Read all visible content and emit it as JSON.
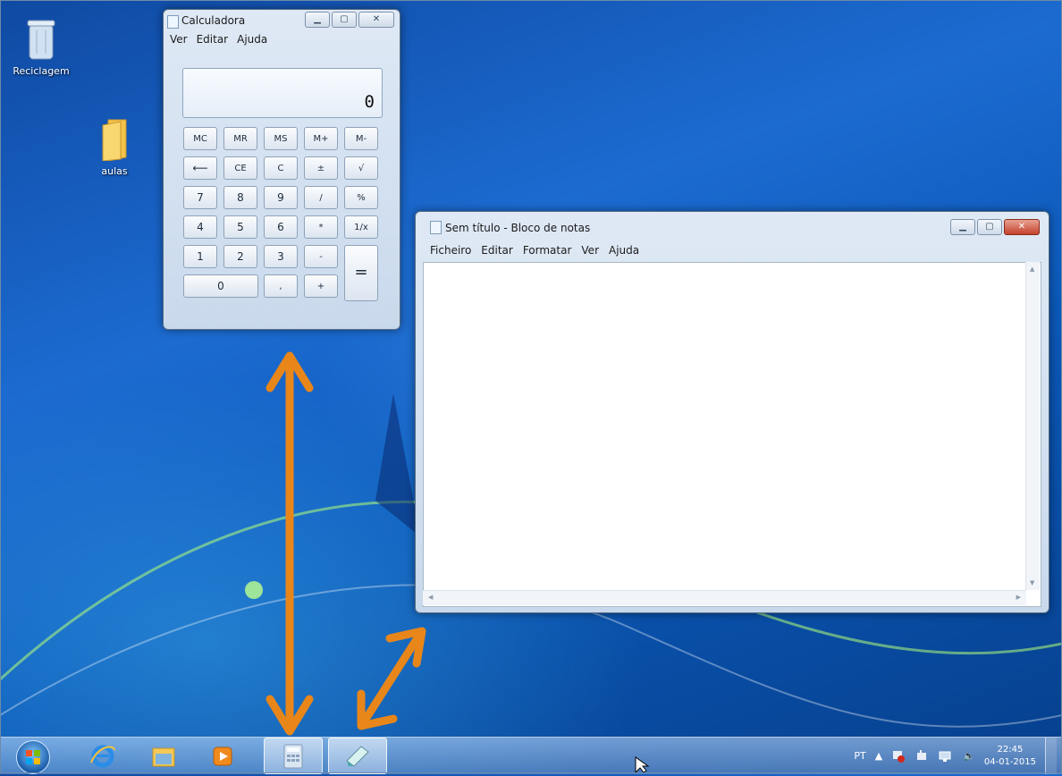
{
  "desktop": {
    "icons": [
      {
        "label": "Reciclagem",
        "icon": "recycle-bin-icon"
      },
      {
        "label": "aulas",
        "icon": "folder-icon"
      }
    ]
  },
  "calculator": {
    "title": "Calculadora",
    "menu": [
      "Ver",
      "Editar",
      "Ajuda"
    ],
    "display": "0",
    "keys": {
      "mc": "MC",
      "mr": "MR",
      "ms": "MS",
      "mplus": "M+",
      "mminus": "M-",
      "backspace": "⟵",
      "ce": "CE",
      "c": "C",
      "plusminus": "±",
      "sqrt": "√",
      "k7": "7",
      "k8": "8",
      "k9": "9",
      "div": "/",
      "pct": "%",
      "k4": "4",
      "k5": "5",
      "k6": "6",
      "mul": "*",
      "recip": "1/x",
      "k1": "1",
      "k2": "2",
      "k3": "3",
      "sub": "-",
      "eq": "=",
      "k0": "0",
      "dot": ",",
      "add": "+"
    }
  },
  "notepad": {
    "title": "Sem título - Bloco de notas",
    "menu": [
      "Ficheiro",
      "Editar",
      "Formatar",
      "Ver",
      "Ajuda"
    ],
    "content": ""
  },
  "taskbar": {
    "apps": [
      "start-icon",
      "internet-explorer-icon",
      "file-explorer-icon",
      "media-player-icon",
      "calculator-icon",
      "notepad-icon"
    ],
    "tray": {
      "language": "PT",
      "time": "22:45",
      "date": "04-01-2015"
    }
  },
  "colors": {
    "annotation_arrow": "#e8861a"
  }
}
